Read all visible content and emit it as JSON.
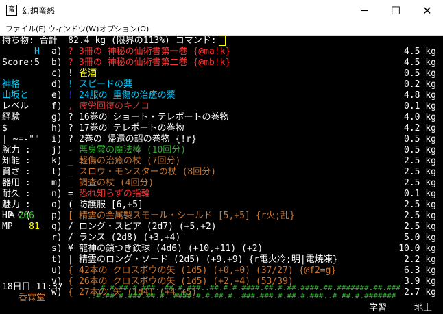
{
  "window": {
    "title": "幻想蛮怒",
    "icon": "app-icon",
    "minimize": "─",
    "maximize": "☐",
    "close": "✕"
  },
  "menu": [
    "ファイル(F)",
    "ウィンドウ(W)",
    "オプション(O)"
  ],
  "header": "持ち物: 合計  82.4 kg (限界の113%) コマンド:",
  "side": [
    {
      "text": "      H",
      "color": "#00d0ff"
    },
    {
      "text": "Score:5",
      "color": "#fff"
    },
    {
      "text": "",
      "color": "#fff"
    },
    {
      "text": "神格",
      "color": "#00d0ff"
    },
    {
      "text": "山坂と",
      "color": "#00d0ff"
    },
    {
      "text": "レベル",
      "color": "#fff"
    },
    {
      "text": "経験",
      "color": "#fff"
    },
    {
      "text": "$",
      "color": "#fff"
    },
    {
      "text": "| ~=-\"\"",
      "color": "#fff"
    },
    {
      "text": "腕力 :",
      "color": "#fff"
    },
    {
      "text": "知能 :",
      "color": "#fff"
    },
    {
      "text": "賢さ :",
      "color": "#fff"
    },
    {
      "text": "器用 :",
      "color": "#fff"
    },
    {
      "text": "耐久 :",
      "color": "#fff"
    },
    {
      "text": "魅力 :",
      "color": "#fff"
    },
    {
      "text": " ＡＣ(",
      "color": "#fff"
    }
  ],
  "hp": {
    "label": "HP",
    "value": "266"
  },
  "mp": {
    "label": "MP",
    "value": "81"
  },
  "items": [
    {
      "letter": "a)",
      "glyph": "?",
      "glyph_color": "#f33",
      "name": "3冊の 神秘の仙術書第一巻 {@ma!k}",
      "color": "#f33",
      "weight": "4.5 kg"
    },
    {
      "letter": "b)",
      "glyph": "?",
      "glyph_color": "#f33",
      "name": "3冊の 神秘の仙術書第二巻 {@mb!k}",
      "color": "#f33",
      "weight": "4.5 kg"
    },
    {
      "letter": "c)",
      "glyph": "!",
      "glyph_color": "#fff",
      "name": "雀酒",
      "color": "#ff0",
      "weight": "0.5 kg"
    },
    {
      "letter": "d)",
      "glyph": "!",
      "glyph_color": "#0cf",
      "name": "スピードの薬",
      "color": "#0cf",
      "weight": "0.2 kg"
    },
    {
      "letter": "e)",
      "glyph": "!",
      "glyph_color": "#33f",
      "name": "24服の 重傷の治癒の薬",
      "color": "#0cf",
      "weight": "4.8 kg"
    },
    {
      "letter": "f)",
      "glyph": ",",
      "glyph_color": "#c33",
      "name": "疲労回復のキノコ",
      "color": "#c33",
      "weight": "0.1 kg"
    },
    {
      "letter": "g)",
      "glyph": "?",
      "glyph_color": "#fff",
      "name": "16巻の ショート・テレポートの巻物",
      "color": "#fff",
      "weight": "4.0 kg"
    },
    {
      "letter": "h)",
      "glyph": "?",
      "glyph_color": "#fff",
      "name": "17巻の テレポートの巻物",
      "color": "#fff",
      "weight": "4.2 kg"
    },
    {
      "letter": "i)",
      "glyph": "?",
      "glyph_color": "#fff",
      "name": "2巻の 帰還の詔の巻物 {!r}",
      "color": "#fff",
      "weight": "0.5 kg"
    },
    {
      "letter": "j)",
      "glyph": "-",
      "glyph_color": "#3a3",
      "name": "悪臭雲の魔法棒 (10回分)",
      "color": "#3a3",
      "weight": "0.5 kg"
    },
    {
      "letter": "k)",
      "glyph": "_",
      "glyph_color": "#c73",
      "name": "軽傷の治癒の杖 (7回分)",
      "color": "#c73",
      "weight": "2.5 kg"
    },
    {
      "letter": "l)",
      "glyph": "_",
      "glyph_color": "#c73",
      "name": "スロウ・モンスターの杖 (8回分)",
      "color": "#c73",
      "weight": "2.5 kg"
    },
    {
      "letter": "m)",
      "glyph": "_",
      "glyph_color": "#c73",
      "name": "調査の杖 (4回分)",
      "color": "#c73",
      "weight": "2.5 kg"
    },
    {
      "letter": "n)",
      "glyph": "=",
      "glyph_color": "#fff",
      "name": "恐れ知らずの指輪",
      "color": "#f33",
      "weight": "0.1 kg"
    },
    {
      "letter": "o)",
      "glyph": "(",
      "glyph_color": "#fff",
      "name": "防護服 [6,+5]",
      "color": "#fff",
      "weight": "2.5 kg"
    },
    {
      "letter": "p)",
      "glyph": "[",
      "glyph_color": "#c73",
      "name": "精霊の金属製スモール・シールド [5,+5] {r火;乱}",
      "color": "#c73",
      "weight": "2.5 kg"
    },
    {
      "letter": "q)",
      "glyph": "/",
      "glyph_color": "#fff",
      "name": "ロング・スピア (2d7) (+5,+2)",
      "color": "#fff",
      "weight": "2.5 kg"
    },
    {
      "letter": "r)",
      "glyph": "/",
      "glyph_color": "#fff",
      "name": "ランス (2d8) (+3,+4)",
      "color": "#fff",
      "weight": "5.0 kg"
    },
    {
      "letter": "s)",
      "glyph": "¥",
      "glyph_color": "#fff",
      "name": "龍神の鎖つき鉄球 (4d6) (+10,+11) (+2)",
      "color": "#fff",
      "weight": "10.0 kg"
    },
    {
      "letter": "t)",
      "glyph": "|",
      "glyph_color": "#fff",
      "name": "精霊のロング・ソード (2d5) (+9,+9) {r電火冷;明|電焼凍}",
      "color": "#fff",
      "weight": "2.2 kg"
    },
    {
      "letter": "u)",
      "glyph": "{",
      "glyph_color": "#c73",
      "name": "42本の クロスボウの矢 (1d5) (+0,+0) (37/27) {@f2=g}",
      "color": "#c73",
      "weight": "6.3 kg"
    },
    {
      "letter": "v)",
      "glyph": "{",
      "glyph_color": "#c73",
      "name": "26本の クロスボウの矢 (1d5) (+2,+4) (53/39)",
      "color": "#c73",
      "weight": "3.9 kg"
    },
    {
      "letter": "w)",
      "glyph": "{",
      "glyph_color": "#c73",
      "name": "27本の 矢 (1d4) (+4,+5)",
      "color": "#c73",
      "weight": "2.7 kg"
    }
  ],
  "footer": {
    "date": "18日目 11:37",
    "location": "香霖堂",
    "map1": "  .#.#.##.#.###..##.#.###..##.#.#.####.##.#.##.####.##.#######.##.###",
    "map2": "..#.##.#.###.##.#..####.#.#.##.#..###.###.#.##.#.###..#.##.#.#######",
    "status1": "学習",
    "status2": "地上"
  }
}
